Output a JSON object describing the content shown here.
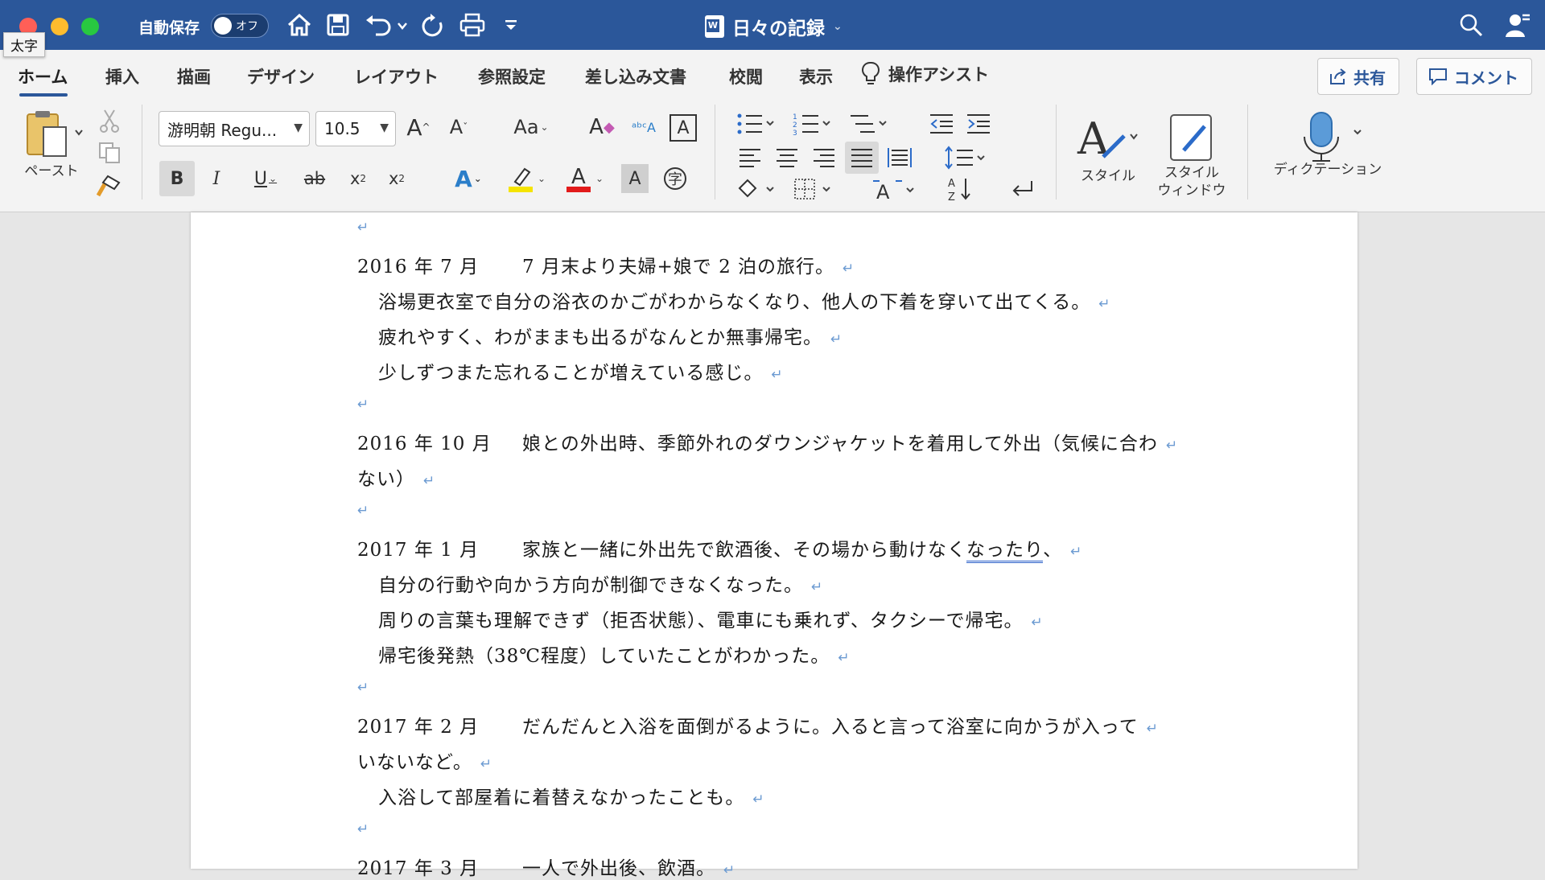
{
  "window": {
    "tooltip": "太字",
    "autosave_label": "自動保存",
    "autosave_state": "オフ",
    "title": "日々の記録"
  },
  "tabs": [
    "ホーム",
    "挿入",
    "描画",
    "デザイン",
    "レイアウト",
    "参照設定",
    "差し込み文書",
    "校閲",
    "表示"
  ],
  "tell_me": "操作アシスト",
  "share_label": "共有",
  "comment_label": "コメント",
  "ribbon": {
    "paste_label": "ペースト",
    "font_name": "游明朝 Regu...",
    "font_size": "10.5",
    "change_case": "Aa",
    "styles_label": "スタイル",
    "styles_pane_label": "スタイル\nウィンドウ",
    "dictation_label": "ディクテーション",
    "bold": "B",
    "italic": "I",
    "underline": "U",
    "strike": "ab"
  },
  "document": {
    "paragraph_mark": "↵",
    "lines": [
      {
        "type": "blank"
      },
      {
        "type": "entry",
        "date": "2016 年 7 月",
        "text": "7 月末より夫婦+娘で 2 泊の旅行。"
      },
      {
        "type": "indent",
        "text": "浴場更衣室で自分の浴衣のかごがわからなくなり、他人の下着を穿いて出てくる。"
      },
      {
        "type": "indent",
        "text": "疲れやすく、わがままも出るがなんとか無事帰宅。"
      },
      {
        "type": "indent",
        "text": "少しずつまた忘れることが増えている感じ。"
      },
      {
        "type": "blank"
      },
      {
        "type": "entry",
        "date": "2016 年 10 月",
        "text": "娘との外出時、季節外れのダウンジャケットを着用して外出（気候に合わ"
      },
      {
        "type": "cont",
        "text": "ない）"
      },
      {
        "type": "blank"
      },
      {
        "type": "entry",
        "date": "2017 年 1 月",
        "text": "家族と一緒に外出先で飲酒後、その場から動けなく",
        "underlined": "なったり",
        "after": "、"
      },
      {
        "type": "indent",
        "text": "自分の行動や向かう方向が制御できなくなった。"
      },
      {
        "type": "indent",
        "text": "周りの言葉も理解できず（拒否状態）、電車にも乗れず、タクシーで帰宅。"
      },
      {
        "type": "indent",
        "text": "帰宅後発熱（38℃程度）していたことがわかった。"
      },
      {
        "type": "blank"
      },
      {
        "type": "entry",
        "date": "2017 年 2 月",
        "text": "だんだんと入浴を面倒がるように。入ると言って浴室に向かうが入って"
      },
      {
        "type": "cont",
        "text": "いないなど。"
      },
      {
        "type": "indent",
        "text": "入浴して部屋着に着替えなかったことも。"
      },
      {
        "type": "blank"
      },
      {
        "type": "entry",
        "date": "2017 年 3 月",
        "text": "一人で外出後、飲酒。"
      }
    ]
  }
}
